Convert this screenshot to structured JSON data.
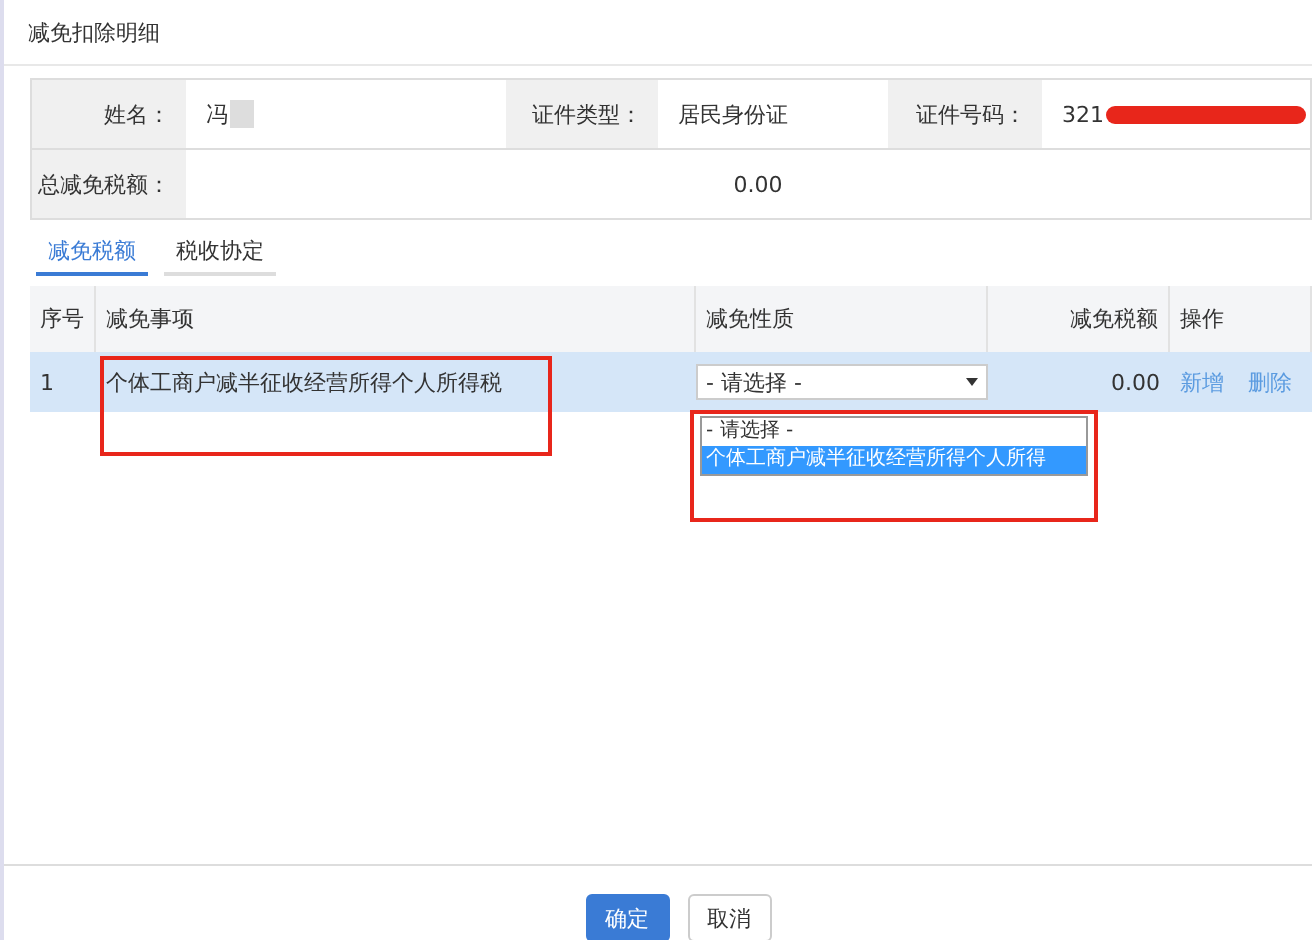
{
  "dialog": {
    "title": "减免扣除明细"
  },
  "info": {
    "name_label": "姓名：",
    "name_value": "冯",
    "id_type_label": "证件类型：",
    "id_type_value": "居民身份证",
    "id_no_label": "证件号码：",
    "id_no_value": "321",
    "total_label": "总减免税额：",
    "total_value": "0.00"
  },
  "tabs": [
    {
      "label": "减免税额",
      "selected": true
    },
    {
      "label": "税收协定",
      "selected": false
    }
  ],
  "table": {
    "columns": [
      "序号",
      "减免事项",
      "减免性质",
      "减免税额",
      "操作"
    ],
    "rows": [
      {
        "index": "1",
        "item": "个体工商户减半征收经营所得个人所得税",
        "nature": "- 请选择 -",
        "amount": "0.00",
        "actions": [
          "新增",
          "删除"
        ],
        "selected": true
      }
    ]
  },
  "dropdown": {
    "options": [
      {
        "label": "- 请选择 -",
        "selected": false
      },
      {
        "label": "个体工商户减半征收经营所得个人所得",
        "selected": true
      }
    ]
  },
  "buttons": [
    {
      "label": "确定",
      "kind": "primary"
    },
    {
      "label": "取消",
      "kind": "default"
    }
  ]
}
